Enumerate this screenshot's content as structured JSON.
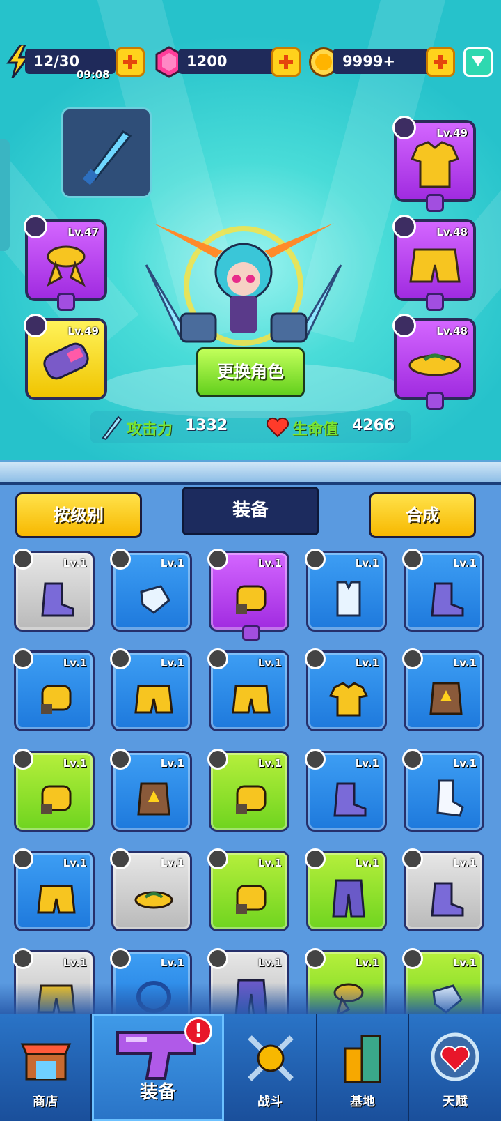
{
  "resources": {
    "energy": "12/30",
    "energy_timer": "09:08",
    "gems": "1200",
    "coins": "9999+"
  },
  "equipped": {
    "necklace_level": "Lv.47",
    "glove_level": "Lv.49",
    "shirt_level": "Lv.49",
    "shorts_level": "Lv.48",
    "shoes_level": "Lv.48"
  },
  "change_character_label": "更换角色",
  "stats": {
    "attack_label": "攻击力",
    "attack_value": "1332",
    "hp_label": "生命值",
    "hp_value": "4266"
  },
  "toolbar": {
    "sort_label": "按级别",
    "title": "装备",
    "merge_label": "合成"
  },
  "inventory": {
    "level": "Lv.1"
  },
  "nav": {
    "shop": "商店",
    "equipment": "装备",
    "battle": "战斗",
    "base": "基地",
    "talent": "天赋"
  },
  "colors": {
    "purple": "#b543f0",
    "gold": "#f7d81a",
    "blue": "#2a8ae8",
    "gray": "#cfcfcf",
    "green": "#8fe02a"
  }
}
